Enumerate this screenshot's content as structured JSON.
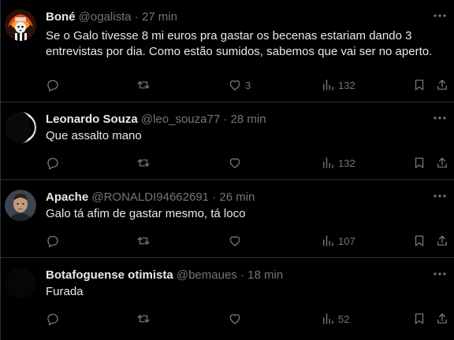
{
  "tweets": [
    {
      "name": "Boné",
      "handle": "@ogalista",
      "separator": "·",
      "time": "27 min",
      "text": "Se o Galo tivesse 8 mi euros pra gastar os becenas estariam dando 3 entrevistas por dia. Como estão sumidos, sabemos que vai ser no aperto.",
      "likes": "3",
      "views": "132"
    },
    {
      "name": "Leonardo Souza",
      "handle": "@leo_souza77",
      "separator": "·",
      "time": "28 min",
      "text": "Que assalto mano",
      "likes": "",
      "views": "132"
    },
    {
      "name": "Apache",
      "handle": "@RONALDI94662691",
      "separator": "·",
      "time": "26 min",
      "text": "Galo tá afim de gastar mesmo, tá loco",
      "likes": "",
      "views": "107"
    },
    {
      "name": "Botafoguense otimista",
      "handle": "@bemaues",
      "separator": "·",
      "time": "18 min",
      "text": "Furada",
      "likes": "",
      "views": "52"
    }
  ],
  "icons": {
    "reply": "reply-icon",
    "retweet": "retweet-icon",
    "like": "heart-icon",
    "views": "views-icon",
    "bookmark": "bookmark-icon",
    "share": "share-icon",
    "more": "more-icon"
  },
  "colors": {
    "background": "#000000",
    "text": "#e7e9ea",
    "secondary": "#71767b",
    "border": "#2f3336"
  }
}
